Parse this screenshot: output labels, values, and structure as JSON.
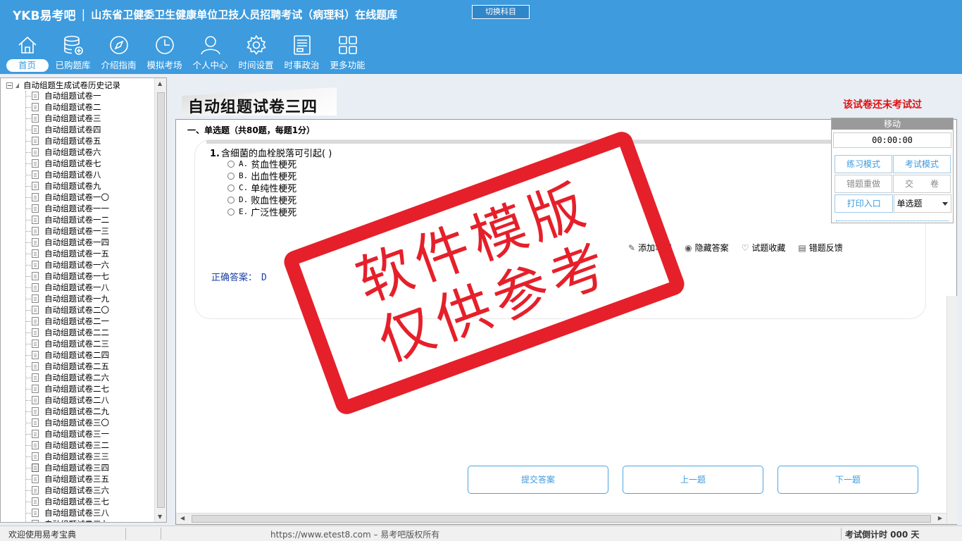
{
  "header": {
    "brand": "YKB易考吧",
    "title": "山东省卫健委卫生健康单位卫技人员招聘考试（病理科）在线题库",
    "switch_button": "切换科目",
    "nav": [
      {
        "label": "首页",
        "icon": "home-icon",
        "active": true
      },
      {
        "label": "已购题库",
        "icon": "database-icon"
      },
      {
        "label": "介绍指南",
        "icon": "compass-icon"
      },
      {
        "label": "模拟考场",
        "icon": "clock-icon"
      },
      {
        "label": "个人中心",
        "icon": "user-icon"
      },
      {
        "label": "时间设置",
        "icon": "gear-icon"
      },
      {
        "label": "时事政治",
        "icon": "news-icon"
      },
      {
        "label": "更多功能",
        "icon": "grid-icon"
      }
    ]
  },
  "tree": {
    "root": "自动组题生成试卷历史记录",
    "toggle": "−",
    "items": [
      "自动组题试卷一",
      "自动组题试卷二",
      "自动组题试卷三",
      "自动组题试卷四",
      "自动组题试卷五",
      "自动组题试卷六",
      "自动组题试卷七",
      "自动组题试卷八",
      "自动组题试卷九",
      "自动组题试卷一〇",
      "自动组题试卷一一",
      "自动组题试卷一二",
      "自动组题试卷一三",
      "自动组题试卷一四",
      "自动组题试卷一五",
      "自动组题试卷一六",
      "自动组题试卷一七",
      "自动组题试卷一八",
      "自动组题试卷一九",
      "自动组题试卷二〇",
      "自动组题试卷二一",
      "自动组题试卷二二",
      "自动组题试卷二三",
      "自动组题试卷二四",
      "自动组题试卷二五",
      "自动组题试卷二六",
      "自动组题试卷二七",
      "自动组题试卷二八",
      "自动组题试卷二九",
      "自动组题试卷三〇",
      "自动组题试卷三一",
      "自动组题试卷三二",
      "自动组题试卷三三",
      "自动组题试卷三四",
      "自动组题试卷三五",
      "自动组题试卷三六",
      "自动组题试卷三七",
      "自动组题试卷三八",
      "自动组题试卷三九"
    ],
    "current_index": 33
  },
  "main": {
    "title": "自动组题试卷三四",
    "exam_status": "该试卷还未考试过",
    "section_title": "一、单选题（共80题，每题1分）",
    "question": {
      "number": "1.",
      "stem": "含细菌的血栓脱落可引起( )",
      "options": [
        {
          "key": "A.",
          "text": "贫血性梗死"
        },
        {
          "key": "B.",
          "text": "出血性梗死"
        },
        {
          "key": "C.",
          "text": "单纯性梗死"
        },
        {
          "key": "D.",
          "text": "败血性梗死"
        },
        {
          "key": "E.",
          "text": "广泛性梗死"
        }
      ]
    },
    "tools": [
      {
        "label": "添加笔记",
        "icon": "pencil-icon"
      },
      {
        "label": "隐藏答案",
        "icon": "eye-icon"
      },
      {
        "label": "试题收藏",
        "icon": "heart-icon"
      },
      {
        "label": "错题反馈",
        "icon": "feedback-icon"
      }
    ],
    "answer_label": "正确答案：",
    "answer_value": "D",
    "buttons": {
      "submit": "提交答案",
      "prev": "上一题",
      "next": "下一题"
    }
  },
  "side_panel": {
    "move": "移动",
    "timer": "00:00:00",
    "practice_mode": "练习模式",
    "exam_mode": "考试模式",
    "redo_wrong": "错题重做",
    "hand_in": "交　　卷",
    "print": "打印入口",
    "question_type": "单选题"
  },
  "statusbar": {
    "welcome": "欢迎使用易考宝典",
    "copyright": "https://www.etest8.com – 易考吧版权所有",
    "countdown": "考试倒计时 000 天"
  },
  "watermark": {
    "line1": "软件模版",
    "line2": "仅供参考"
  },
  "colors": {
    "header_bg": "#3d9bde",
    "stamp_red": "#e5202a",
    "status_red": "#dd1111",
    "answer_blue": "#1a3fa6"
  }
}
